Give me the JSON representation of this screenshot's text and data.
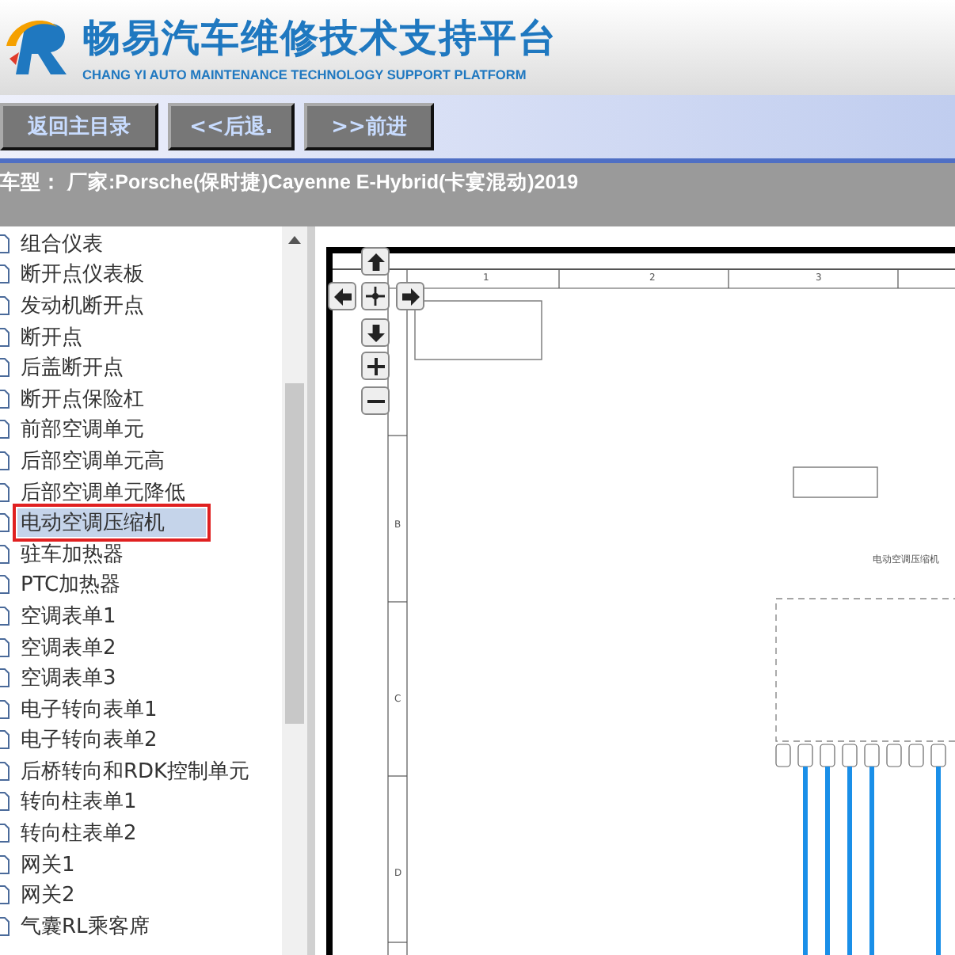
{
  "header": {
    "title": "畅易汽车维修技术支持平台",
    "subtitle": "CHANG YI AUTO MAINTENANCE TECHNOLOGY SUPPORT PLATFORM"
  },
  "nav_buttons": [
    "返回主目录",
    "<<后退.",
    ">>前进"
  ],
  "vehicle_bar": {
    "text": "车型： 厂家:Porsche(保时捷)Cayenne E-Hybrid(卡宴混动)2019"
  },
  "sidebar": {
    "items": [
      {
        "label": "组合仪表",
        "selected": false
      },
      {
        "label": "断开点仪表板",
        "selected": false
      },
      {
        "label": "发动机断开点",
        "selected": false
      },
      {
        "label": "断开点",
        "selected": false
      },
      {
        "label": "后盖断开点",
        "selected": false
      },
      {
        "label": "断开点保险杠",
        "selected": false
      },
      {
        "label": "前部空调单元",
        "selected": false
      },
      {
        "label": "后部空调单元高",
        "selected": false
      },
      {
        "label": "后部空调单元降低",
        "selected": false
      },
      {
        "label": "电动空调压缩机",
        "selected": true
      },
      {
        "label": "驻车加热器",
        "selected": false
      },
      {
        "label": "PTC加热器",
        "selected": false
      },
      {
        "label": "空调表单1",
        "selected": false
      },
      {
        "label": "空调表单2",
        "selected": false
      },
      {
        "label": "空调表单3",
        "selected": false
      },
      {
        "label": "电子转向表单1",
        "selected": false
      },
      {
        "label": "电子转向表单2",
        "selected": false
      },
      {
        "label": "后桥转向和RDK控制单元",
        "selected": false
      },
      {
        "label": "转向柱表单1",
        "selected": false
      },
      {
        "label": "转向柱表单2",
        "selected": false
      },
      {
        "label": "网关1",
        "selected": false
      },
      {
        "label": "网关2",
        "selected": false
      },
      {
        "label": "气囊RL乘客席",
        "selected": false
      }
    ]
  },
  "diagram": {
    "column_labels": [
      "1",
      "2",
      "3"
    ],
    "row_labels": [
      "B",
      "C",
      "D"
    ],
    "title": "电动空调压缩机"
  }
}
